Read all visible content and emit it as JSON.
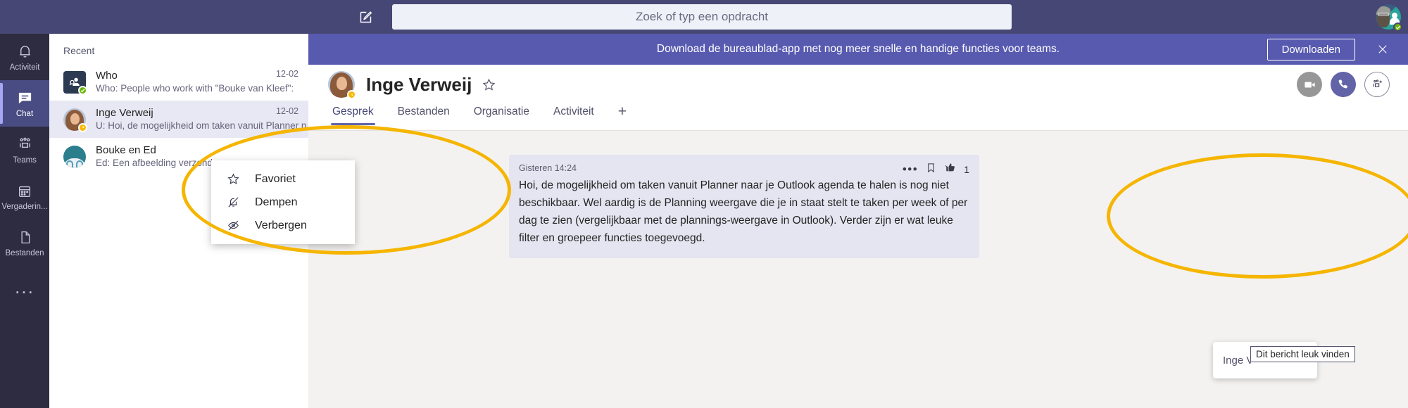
{
  "topbar": {
    "compose_icon": "compose-pencil-icon",
    "search_placeholder": "Zoek of typ een opdracht",
    "avatar_name": "user-avatar",
    "presence": "available"
  },
  "rail": {
    "items": [
      {
        "label": "Activiteit",
        "icon": "bell-icon",
        "active": false
      },
      {
        "label": "Chat",
        "icon": "chat-icon",
        "active": true
      },
      {
        "label": "Teams",
        "icon": "teams-icon",
        "active": false
      },
      {
        "label": "Vergaderin...",
        "icon": "calendar-icon",
        "active": false
      },
      {
        "label": "Bestanden",
        "icon": "files-icon",
        "active": false
      }
    ],
    "more_label": "..."
  },
  "chatlist": {
    "title": "Recent",
    "rows": [
      {
        "name": "Who",
        "preview": "Who: People who work with \"Bouke van Kleef\":",
        "time": "12-02",
        "avatar": "who-app-icon",
        "presence": "available",
        "selected": false
      },
      {
        "name": "Inge Verweij",
        "preview": "U: Hoi, de mogelijkheid om taken vanuit Planner n",
        "time": "12-02",
        "avatar": "inge-avatar",
        "presence": "away",
        "selected": true
      },
      {
        "name": "Bouke en Ed",
        "preview": "Ed: Een afbeelding verzonden",
        "time": "",
        "avatar": "group-avatar",
        "presence": "none",
        "selected": false
      }
    ]
  },
  "banner": {
    "text": "Download de bureaublad-app met nog meer snelle en handige functies voor teams.",
    "button_label": "Downloaden",
    "close_icon": "close-icon"
  },
  "conversation": {
    "title": "Inge Verweij",
    "favorite_icon": "star-icon",
    "tabs": [
      {
        "label": "Gesprek",
        "active": true
      },
      {
        "label": "Bestanden",
        "active": false
      },
      {
        "label": "Organisatie",
        "active": false
      },
      {
        "label": "Activiteit",
        "active": false
      }
    ],
    "add_tab_label": "+",
    "actions": [
      {
        "name": "video-call-button",
        "icon": "video-camera-icon"
      },
      {
        "name": "audio-call-button",
        "icon": "phone-icon"
      },
      {
        "name": "add-people-button",
        "icon": "add-people-icon"
      }
    ]
  },
  "message": {
    "timestamp": "Gisteren 14:24",
    "body": "Hoi, de mogelijkheid om taken vanuit Planner naar je Outlook agenda te halen is nog niet beschikbaar. Wel aardig is de Planning weergave die je in staat stelt te taken per week of per dag te zien (vergelijkbaar met de plannings-weergave in Outlook). Verder zijn er wat leuke filter en groepeer functies toegevoegd.",
    "more_icon": "ellipsis-icon",
    "save_icon": "bookmark-icon",
    "like_icon": "thumbs-up-icon",
    "like_count": "1",
    "tooltip": "Dit bericht leuk vinden",
    "popover_name": "Inge V"
  },
  "context_menu": {
    "items": [
      {
        "label": "Favoriet",
        "icon": "star-icon"
      },
      {
        "label": "Dempen",
        "icon": "bell-slash-icon"
      },
      {
        "label": "Verbergen",
        "icon": "eye-slash-icon"
      }
    ]
  },
  "annotations": {
    "highlight_color": "#f5b500",
    "regions": [
      "context-menu-highlight",
      "like-action-highlight"
    ]
  }
}
